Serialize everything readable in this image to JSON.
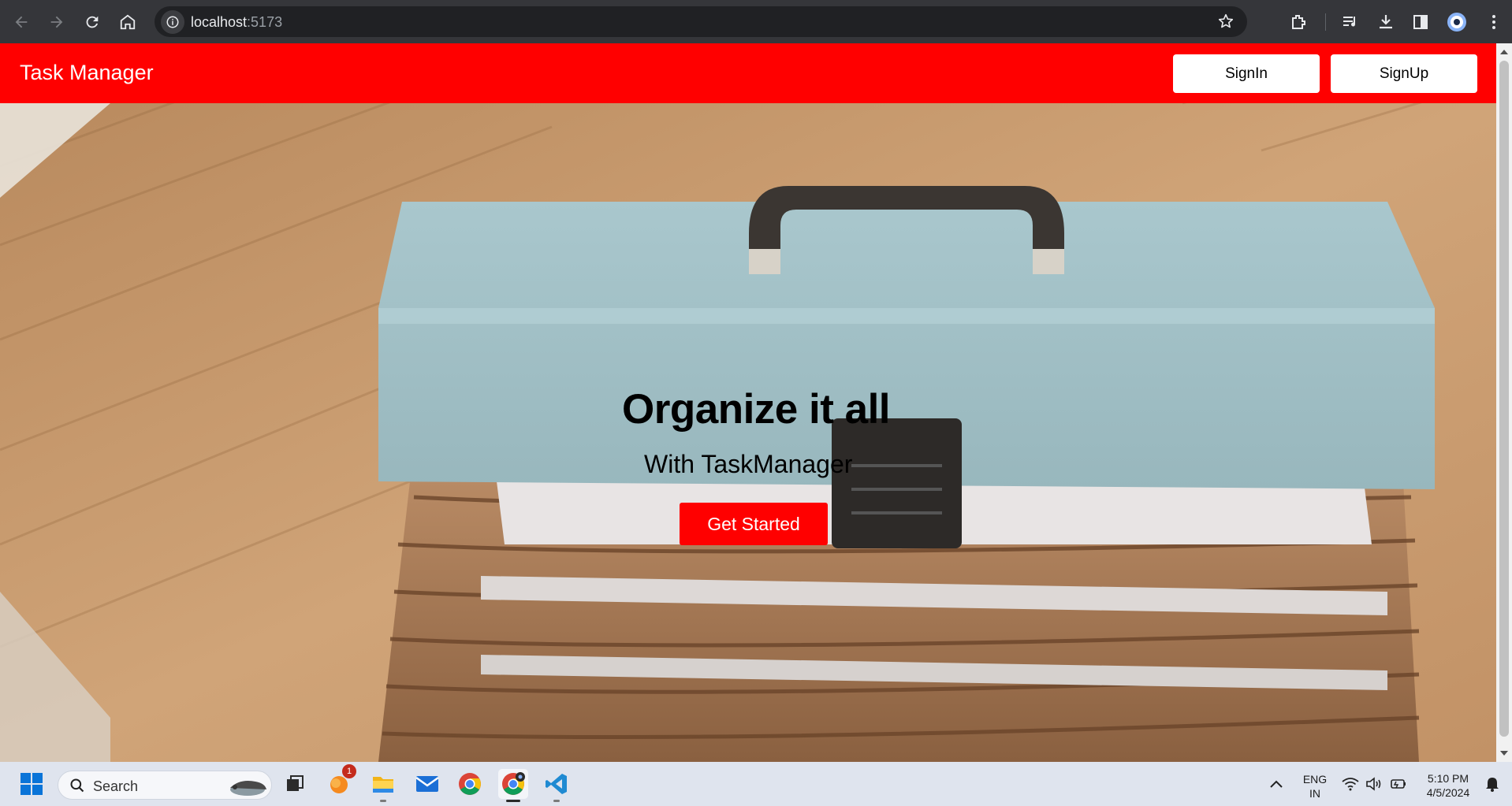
{
  "browser": {
    "url_host": "localhost",
    "url_port": ":5173"
  },
  "navbar": {
    "brand": "Task Manager",
    "signin_label": "SignIn",
    "signup_label": "SignUp",
    "background_color": "#ff0000"
  },
  "hero": {
    "title": "Organize it all",
    "subtitle": "With TaskManager",
    "cta_label": "Get Started"
  },
  "taskbar": {
    "search_label": "Search",
    "notification_count": "1",
    "language": "ENG",
    "region": "IN",
    "time": "5:10 PM",
    "date": "4/5/2024"
  }
}
